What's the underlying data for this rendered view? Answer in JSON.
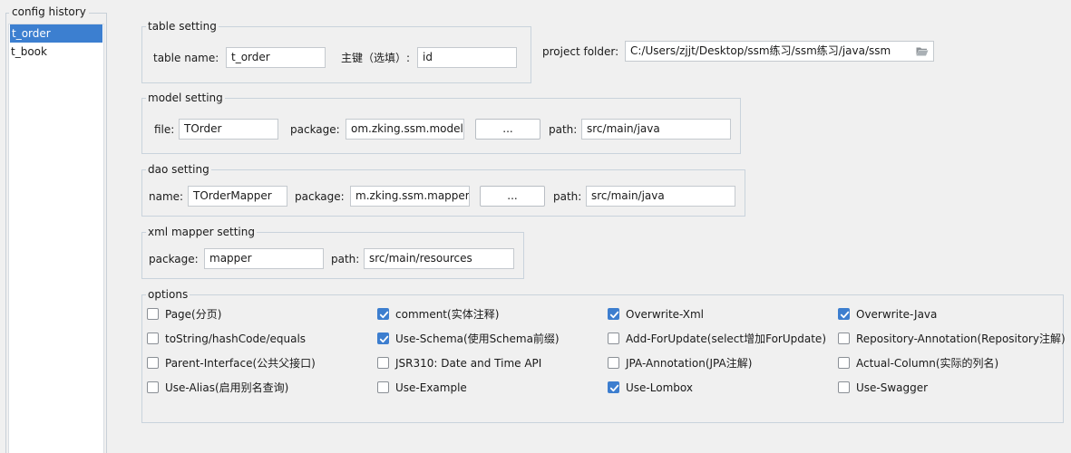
{
  "history": {
    "title": "config history",
    "items": [
      "t_order",
      "t_book"
    ],
    "selected_index": 0
  },
  "table_setting": {
    "title": "table setting",
    "table_name_label": "table  name:",
    "table_name_value": "t_order",
    "pk_label": "主键（选填）:",
    "pk_value": "id"
  },
  "project": {
    "label": "project folder:",
    "value": "C:/Users/zjjt/Desktop/ssm练习/ssm练习/java/ssm"
  },
  "model_setting": {
    "title": "model setting",
    "file_label": "file:",
    "file_value": "TOrder",
    "package_label": "package:",
    "package_value": "om.zking.ssm.model",
    "browse_label": "...",
    "path_label": "path:",
    "path_value": "src/main/java"
  },
  "dao_setting": {
    "title": "dao setting",
    "name_label": "name:",
    "name_value": "TOrderMapper",
    "package_label": "package:",
    "package_value": "m.zking.ssm.mapper",
    "browse_label": "...",
    "path_label": "path:",
    "path_value": "src/main/java"
  },
  "xml_setting": {
    "title": "xml mapper setting",
    "package_label": "package:",
    "package_value": "mapper",
    "path_label": "path:",
    "path_value": "src/main/resources"
  },
  "options": {
    "title": "options",
    "items": [
      {
        "label": "Page(分页)",
        "checked": false
      },
      {
        "label": "comment(实体注释)",
        "checked": true
      },
      {
        "label": "Overwrite-Xml",
        "checked": true
      },
      {
        "label": "Overwrite-Java",
        "checked": true
      },
      {
        "label": "toString/hashCode/equals",
        "checked": false
      },
      {
        "label": "Use-Schema(使用Schema前缀)",
        "checked": true
      },
      {
        "label": "Add-ForUpdate(select增加ForUpdate)",
        "checked": false
      },
      {
        "label": "Repository-Annotation(Repository注解)",
        "checked": false
      },
      {
        "label": "Parent-Interface(公共父接口)",
        "checked": false
      },
      {
        "label": "JSR310: Date and Time API",
        "checked": false
      },
      {
        "label": "JPA-Annotation(JPA注解)",
        "checked": false
      },
      {
        "label": "Actual-Column(实际的列名)",
        "checked": false
      },
      {
        "label": "Use-Alias(启用别名查询)",
        "checked": false
      },
      {
        "label": "Use-Example",
        "checked": false
      },
      {
        "label": "Use-Lombox",
        "checked": true
      },
      {
        "label": "Use-Swagger",
        "checked": false
      }
    ]
  },
  "colors": {
    "selection": "#3c7fd0",
    "checkbox_checked": "#3d7ecf",
    "border": "#c9d3dc"
  }
}
